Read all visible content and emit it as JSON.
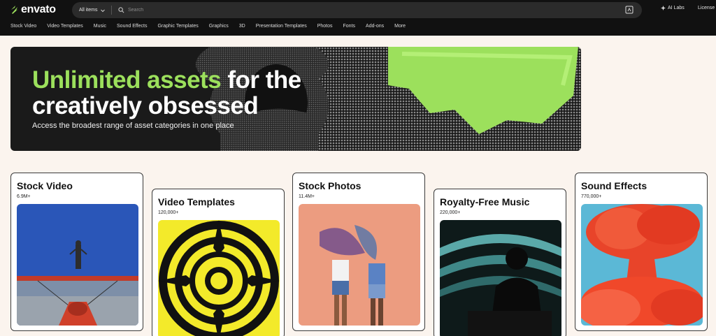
{
  "header": {
    "logo_text": "envato",
    "search": {
      "category_label": "All items",
      "placeholder": "Search"
    },
    "ai_labs_label": "AI Labs",
    "license_label": "License"
  },
  "category_nav": [
    "Stock Video",
    "Video Templates",
    "Music",
    "Sound Effects",
    "Graphic Templates",
    "Graphics",
    "3D",
    "Presentation Templates",
    "Photos",
    "Fonts",
    "Add-ons",
    "More"
  ],
  "hero": {
    "title_accent": "Unlimited assets",
    "title_rest_line1": " for the",
    "title_line2": "creatively obsessed",
    "subtitle": "Access the broadest range of asset categories in one place"
  },
  "cards": [
    {
      "title": "Stock Video",
      "count": "6.9M+",
      "image_alt": "stunt performer standing on red biplane"
    },
    {
      "title": "Video Templates",
      "count": "120,000+",
      "image_alt": "yellow and black psychedelic pattern"
    },
    {
      "title": "Stock Photos",
      "count": "11.4M+",
      "image_alt": "two women with braided hair on peach background"
    },
    {
      "title": "Royalty-Free Music",
      "count": "220,000+",
      "image_alt": "silhouette of DJ with striped lights"
    },
    {
      "title": "Sound Effects",
      "count": "770,000+",
      "image_alt": "red smoke explosion on blue sky"
    }
  ],
  "colors": {
    "accent_green": "#9ce05c",
    "header_bg": "#111111",
    "page_bg": "#fbf4ee"
  }
}
